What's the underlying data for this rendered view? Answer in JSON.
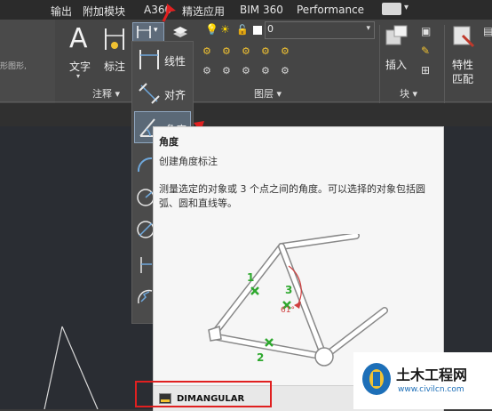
{
  "tabs": {
    "items": [
      "输出",
      "附加模块",
      "A360",
      "精选应用",
      "BIM 360",
      "Performance"
    ]
  },
  "left_fragment": "形图形,",
  "ribbon": {
    "text_label": "文字",
    "dim_label": "标注",
    "annotation_panel": "注释 ▾",
    "layer_panel": "图层 ▾",
    "block_panel": "块 ▾",
    "layer_value": "0",
    "insert_label": "插入",
    "match_label_line1": "特性",
    "match_label_line2": "匹配"
  },
  "dropdown": {
    "items": [
      {
        "label": "线性"
      },
      {
        "label": "对齐"
      },
      {
        "label": "角度"
      }
    ]
  },
  "tooltip": {
    "title": "角度",
    "description": "创建角度标注",
    "body": "测量选定的对象或 3 个点之间的角度。可以选择的对象包括圆弧、圆和直线等。",
    "diagram_labels": {
      "point1": "1",
      "point2": "2",
      "point3": "3",
      "angle": "61°"
    },
    "command": "DIMANGULAR"
  },
  "watermark": {
    "name": "土木工程网",
    "url": "www.civilcn.com"
  },
  "colors": {
    "accent_red": "#e02020",
    "diagram_green": "#2ea82e"
  }
}
